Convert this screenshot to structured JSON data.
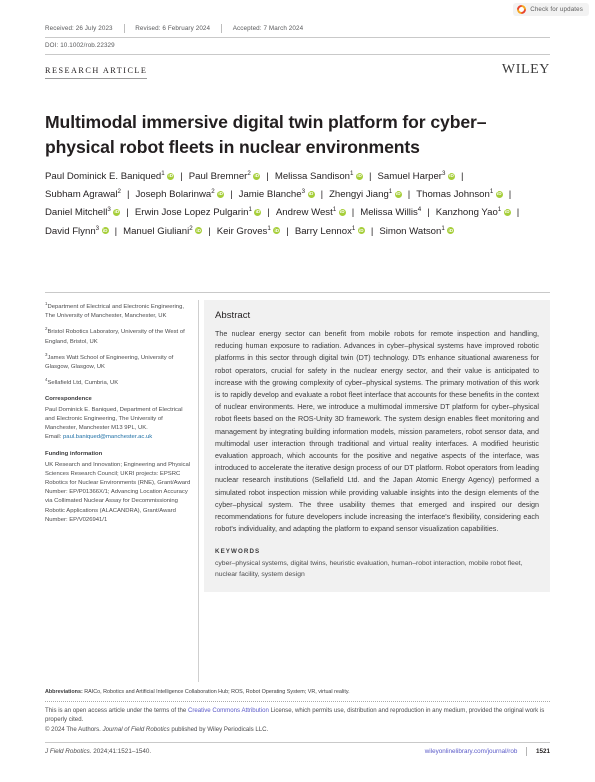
{
  "crossmark": {
    "label": "Check for updates",
    "icon": "crossmark-icon"
  },
  "header": {
    "received": "Received: 26 July 2023",
    "revised": "Revised: 6 February 2024",
    "accepted": "Accepted: 7 March 2024",
    "doi": "DOI: 10.1002/rob.22329",
    "article_type": "RESEARCH ARTICLE",
    "publisher": "WILEY"
  },
  "title": "Multimodal immersive digital twin platform for cyber–physical robot fleets in nuclear environments",
  "authors": [
    {
      "name": "Paul Dominick E. Baniqued",
      "sup": "1",
      "orcid": true
    },
    {
      "name": "Paul Bremner",
      "sup": "2",
      "orcid": true
    },
    {
      "name": "Melissa Sandison",
      "sup": "1",
      "orcid": true
    },
    {
      "name": "Samuel Harper",
      "sup": "3",
      "orcid": true
    },
    {
      "name": "Subham Agrawal",
      "sup": "2",
      "orcid": false
    },
    {
      "name": "Joseph Bolarinwa",
      "sup": "2",
      "orcid": true
    },
    {
      "name": "Jamie Blanche",
      "sup": "3",
      "orcid": true
    },
    {
      "name": "Zhengyi Jiang",
      "sup": "1",
      "orcid": true
    },
    {
      "name": "Thomas Johnson",
      "sup": "1",
      "orcid": true
    },
    {
      "name": "Daniel Mitchell",
      "sup": "3",
      "orcid": true
    },
    {
      "name": "Erwin Jose Lopez Pulgarin",
      "sup": "1",
      "orcid": true
    },
    {
      "name": "Andrew West",
      "sup": "1",
      "orcid": true
    },
    {
      "name": "Melissa Willis",
      "sup": "4",
      "orcid": false
    },
    {
      "name": "Kanzhong Yao",
      "sup": "1",
      "orcid": true
    },
    {
      "name": "David Flynn",
      "sup": "3",
      "orcid": true
    },
    {
      "name": "Manuel Giuliani",
      "sup": "2",
      "orcid": true
    },
    {
      "name": "Keir Groves",
      "sup": "1",
      "orcid": true
    },
    {
      "name": "Barry Lennox",
      "sup": "1",
      "orcid": true
    },
    {
      "name": "Simon Watson",
      "sup": "1",
      "orcid": true
    }
  ],
  "affiliations": [
    {
      "sup": "1",
      "text": "Department of Electrical and Electronic Engineering, The University of Manchester, Manchester, UK"
    },
    {
      "sup": "2",
      "text": "Bristol Robotics Laboratory, University of the West of England, Bristol, UK"
    },
    {
      "sup": "3",
      "text": "James Watt School of Engineering, University of Glasgow, Glasgow, UK"
    },
    {
      "sup": "4",
      "text": "Sellafield Ltd, Cumbria, UK"
    }
  ],
  "correspondence": {
    "heading": "Correspondence",
    "body": "Paul Dominick E. Baniqued, Department of Electrical and Electronic Engineering, The University of Manchester, Manchester M13 9PL, UK.",
    "email_label": "Email:",
    "email": "paul.baniqued@manchester.ac.uk"
  },
  "funding": {
    "heading": "Funding information",
    "body": "UK Research and Innovation; Engineering and Physical Sciences Research Council; UKRI projects: EPSRC Robotics for Nuclear Environments (RNE), Grant/Award Number: EP/P01366X/1; Advancing Location Accuracy via Collimated Nuclear Assay for Decommissioning Robotic Applications (ALACANDRA), Grant/Award Number: EP/V026941/1"
  },
  "abstract": {
    "heading": "Abstract",
    "text": "The nuclear energy sector can benefit from mobile robots for remote inspection and handling, reducing human exposure to radiation. Advances in cyber–physical systems have improved robotic platforms in this sector through digital twin (DT) technology. DTs enhance situational awareness for robot operators, crucial for safety in the nuclear energy sector, and their value is anticipated to increase with the growing complexity of cyber–physical systems. The primary motivation of this work is to rapidly develop and evaluate a robot fleet interface that accounts for these benefits in the context of nuclear environments. Here, we introduce a multimodal immersive DT platform for cyber–physical robot fleets based on the ROS-Unity 3D framework. The system design enables fleet monitoring and management by integrating building information models, mission parameters, robot sensor data, and multimodal user interaction through traditional and virtual reality interfaces. A modified heuristic evaluation approach, which accounts for the positive and negative aspects of the interface, was introduced to accelerate the iterative design process of our DT platform. Robot operators from leading nuclear research institutions (Sellafield Ltd. and the Japan Atomic Energy Agency) performed a simulated robot inspection mission while providing valuable insights into the design elements of the cyber–physical system. The three usability themes that emerged and inspired our design recommendations for future developers include increasing the interface's flexibility, considering each robot's individuality, and adapting the platform to expand sensor visualization capabilities."
  },
  "keywords": {
    "heading": "KEYWORDS",
    "text": "cyber–physical systems, digital twins, heuristic evaluation, human–robot interaction, mobile robot fleet, nuclear facility, system design"
  },
  "footer": {
    "abbrev_label": "Abbreviations:",
    "abbrev_text": "RAICo, Robotics and Artificial Intelligence Collaboration Hub; ROS, Robot Operating System; VR, virtual reality.",
    "license_pre": "This is an open access article under the terms of the ",
    "license_link": "Creative Commons Attribution",
    "license_post": " License, which permits use, distribution and reproduction in any medium, provided the original work is properly cited.",
    "copyright_pre": "© 2024 The Authors. ",
    "copyright_journal": "Journal of Field Robotics",
    "copyright_post": " published by Wiley Periodicals LLC.",
    "citation_journal": "J Field Robotics.",
    "citation_rest": " 2024;41:1521–1540.",
    "url": "wileyonlinelibrary.com/journal/rob",
    "page": "1521"
  }
}
